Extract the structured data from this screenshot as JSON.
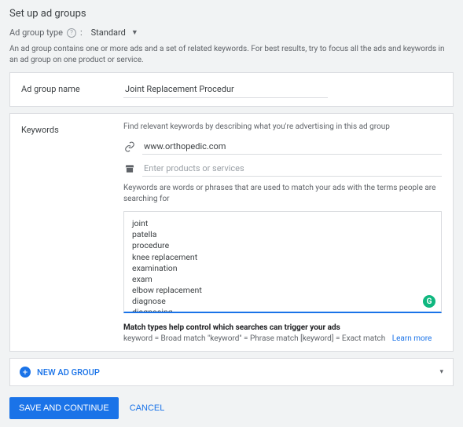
{
  "page": {
    "title": "Set up ad groups",
    "type_label": "Ad group type",
    "type_value": "Standard",
    "intro": "An ad group contains one or more ads and a set of related keywords. For best results, try to focus all the ads and keywords in an ad group on one product or service."
  },
  "name_section": {
    "label": "Ad group name",
    "value": "Joint Replacement Procedur"
  },
  "keywords_section": {
    "label": "Keywords",
    "help_top": "Find relevant keywords by describing what you're advertising in this ad group",
    "url_value": "www.orthopedic.com",
    "product_placeholder": "Enter products or services",
    "help_mid": "Keywords are words or phrases that are used to match your ads with the terms people are searching for",
    "textarea_value": "joint\npatella\nprocedure\nknee replacement\nexamination\nexam\nelbow replacement\ndiagnose\ndiagnosing\ndiagnosis",
    "match_heading": "Match types help control which searches can trigger your ads",
    "match_body": "keyword = Broad match   \"keyword\" = Phrase match   [keyword] = Exact match",
    "learn_more": "Learn more",
    "g_badge": "G"
  },
  "new_group": {
    "label": "NEW AD GROUP"
  },
  "footer": {
    "save": "SAVE AND CONTINUE",
    "cancel": "CANCEL"
  }
}
